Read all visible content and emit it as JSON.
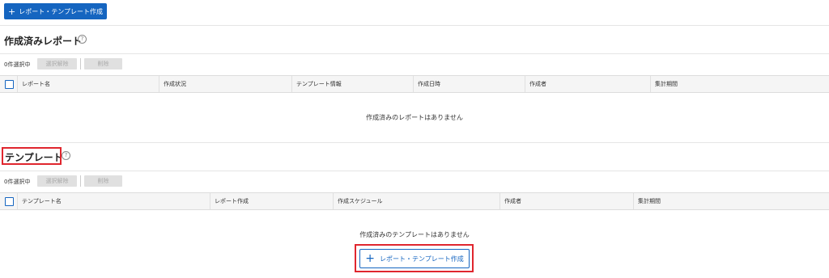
{
  "toolbar": {
    "create_label": "レポート・テンプレート作成",
    "plus_icon": "plus-icon"
  },
  "reports_section": {
    "title": "作成済みレポート",
    "help_icon": "?",
    "selected_count": "0件選択中",
    "deselect_label": "選択解除",
    "delete_label": "削除",
    "columns": [
      "レポート名",
      "作成状況",
      "テンプレート情報",
      "作成日時",
      "作成者",
      "集計期間"
    ],
    "empty_message": "作成済みのレポートはありません"
  },
  "templates_section": {
    "title": "テンプレート",
    "help_icon": "?",
    "selected_count": "0件選択中",
    "deselect_label": "選択解除",
    "delete_label": "削除",
    "columns": [
      "テンプレート名",
      "レポート作成",
      "作成スケジュール",
      "作成者",
      "集計期間"
    ],
    "empty_message": "作成済みのテンプレートはありません",
    "create_label": "レポート・テンプレート作成"
  },
  "colors": {
    "primary": "#1565c0",
    "highlight": "#e0262e",
    "disabled_bg": "#e0e0e0",
    "header_bg": "#f5f5f5"
  }
}
